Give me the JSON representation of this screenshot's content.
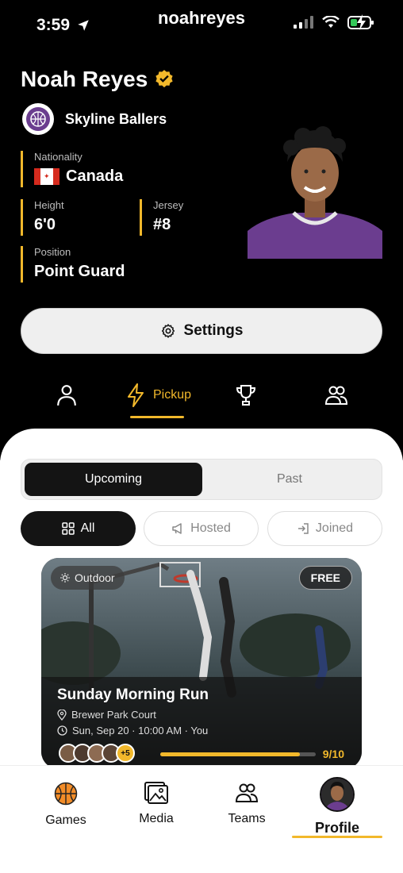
{
  "status_bar": {
    "time": "3:59",
    "username": "noahreyes"
  },
  "profile": {
    "name": "Noah Reyes",
    "team": "Skyline Ballers",
    "nationality_label": "Nationality",
    "nationality": "Canada",
    "height_label": "Height",
    "height": "6'0",
    "jersey_label": "Jersey",
    "jersey": "#8",
    "position_label": "Position",
    "position": "Point Guard"
  },
  "settings_label": "Settings",
  "profile_tabs": {
    "pickup_label": "Pickup"
  },
  "segment": {
    "upcoming": "Upcoming",
    "past": "Past"
  },
  "filters": {
    "all": "All",
    "hosted": "Hosted",
    "joined": "Joined"
  },
  "game_card": {
    "tag": "Outdoor",
    "price": "FREE",
    "title": "Sunday Morning Run",
    "location": "Brewer Park Court",
    "when": "Sun, Sep 20 · 10:00 AM · You",
    "extra_players": "+5",
    "count": "9/10",
    "fill_fraction": 0.9
  },
  "bottom_nav": {
    "games": "Games",
    "media": "Media",
    "teams": "Teams",
    "profile": "Profile"
  },
  "colors": {
    "accent": "#f2b82b",
    "background_dark": "#000000",
    "jersey_purple": "#6b3d8f"
  }
}
